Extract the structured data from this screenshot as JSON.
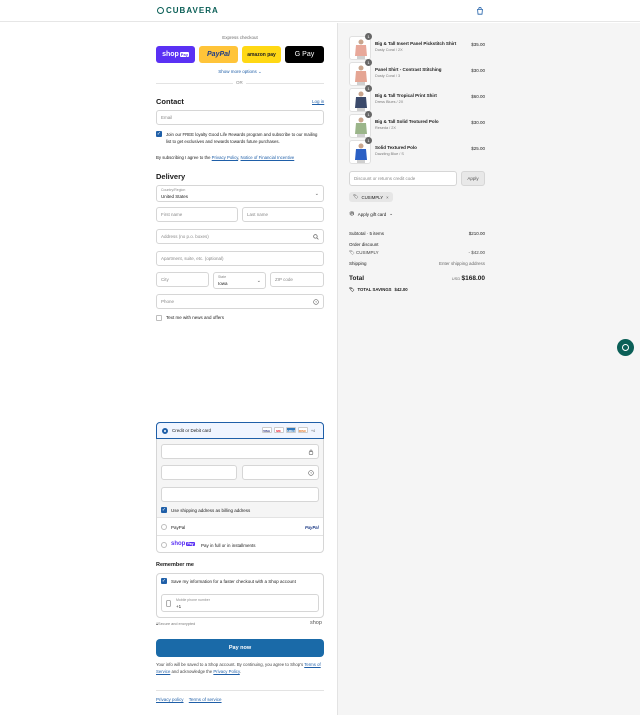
{
  "brand": {
    "name": "CUBAVERA",
    "color": "#0b5f57"
  },
  "express": {
    "label": "Express checkout",
    "buttons": [
      {
        "label": "shop",
        "badge": "Pay",
        "bg": "#5a31f4",
        "fg": "#ffffff"
      },
      {
        "label": "PayPal",
        "bg": "#ffc439",
        "fg": "#1d3b86"
      },
      {
        "label": "amazon pay",
        "bg": "#ffd814",
        "fg": "#222222"
      },
      {
        "label": "G Pay",
        "bg": "#000000",
        "fg": "#ffffff"
      }
    ],
    "more": "Show more options ⌄",
    "or": "OR"
  },
  "contact": {
    "title": "Contact",
    "login": "Log in",
    "email_placeholder": "Email",
    "loyalty_text": "Join our FREE loyalty Good Life Rewards program and subscribe to our mailing list to get exclusives and rewards towards future purchases.",
    "agree_prefix": "By subscribing I agree to the",
    "privacy_link": "Privacy Policy",
    "comma": ",",
    "notice_link": "Notice of Financial Incentive"
  },
  "delivery": {
    "title": "Delivery",
    "country_label": "Country/Region",
    "country_value": "United States",
    "first_name": "First name",
    "last_name": "Last name",
    "address": "Address (no p.o. boxes)",
    "apartment": "Apartment, suite, etc. (optional)",
    "city": "City",
    "state_label": "State",
    "state_value": "Iowa",
    "zip": "ZIP code",
    "phone": "Phone",
    "text_me": "Text me with news and offers"
  },
  "payment": {
    "card_label": "Credit or Debit card",
    "card_logos": [
      {
        "label": "VISA",
        "bg": "#ffffff",
        "fg": "#1a1f71"
      },
      {
        "label": "MC",
        "bg": "#ffffff",
        "fg": "#eb001b"
      },
      {
        "label": "AMEX",
        "bg": "#2e77bc",
        "fg": "#ffffff"
      },
      {
        "label": "DISC",
        "bg": "#ffffff",
        "fg": "#e46f1b"
      }
    ],
    "more_cards": "+4",
    "billing": "Use shipping address as billing address",
    "paypal": "PayPal",
    "paypal_logo": "PayPal",
    "shoppay_label": "shop",
    "shoppay_badge": "Pay",
    "shoppay_text": "Pay in full or in installments"
  },
  "remember": {
    "title": "Remember me",
    "save_text": "Save my information for a faster checkout with a Shop account",
    "mobile_label": "Mobile phone number",
    "mobile_value": "+1",
    "secure": "Secure and encrypted",
    "shop": "shop"
  },
  "pay_now": "Pay now",
  "legal": {
    "prefix": "Your info will be saved to a Shop account. By continuing, you agree to Shop's",
    "terms": "Terms of Service",
    "mid": "and acknowledge the",
    "privacy": "Privacy Policy",
    "end": "."
  },
  "footer": {
    "privacy": "Privacy policy",
    "terms": "Terms of service"
  },
  "cart": {
    "items": [
      {
        "qty": "1",
        "name": "Big & Tall Insert Panel Pickstitch Shirt",
        "variant": "Dusty Coral / 2X",
        "price": "$35.00",
        "color": "#e8a89a"
      },
      {
        "qty": "1",
        "name": "Panel Shirt - Contrast Stitching",
        "variant": "Dusty Coral / 3",
        "price": "$30.00",
        "color": "#e5a593"
      },
      {
        "qty": "1",
        "name": "Big & Tall Tropical Print Shirt",
        "variant": "Dress Blues / 2X",
        "price": "$60.00",
        "color": "#3b4a6b"
      },
      {
        "qty": "1",
        "name": "Big & Tall Solid Textured Polo",
        "variant": "Reseda / 2X",
        "price": "$30.00",
        "color": "#9bb58a"
      },
      {
        "qty": "1",
        "name": "Solid Textured Polo",
        "variant": "Dazzling Blue / S",
        "price": "$25.00",
        "color": "#2a5fc4"
      }
    ],
    "discount_placeholder": "Discount or returns credit code",
    "apply": "Apply",
    "code": "CUSIMPLY",
    "gift_card": "Apply gift card",
    "subtotal_label": "Subtotal · 5 items",
    "subtotal_value": "$210.00",
    "order_discount": "Order discount",
    "code_discount_label": "CUSIMPLY",
    "code_discount_value": "- $42.00",
    "shipping_label": "Shipping",
    "shipping_value": "Enter shipping address",
    "total_label": "Total",
    "currency": "USD",
    "total_value": "$168.00",
    "savings_label": "TOTAL SAVINGS",
    "savings_value": "$42.00"
  }
}
